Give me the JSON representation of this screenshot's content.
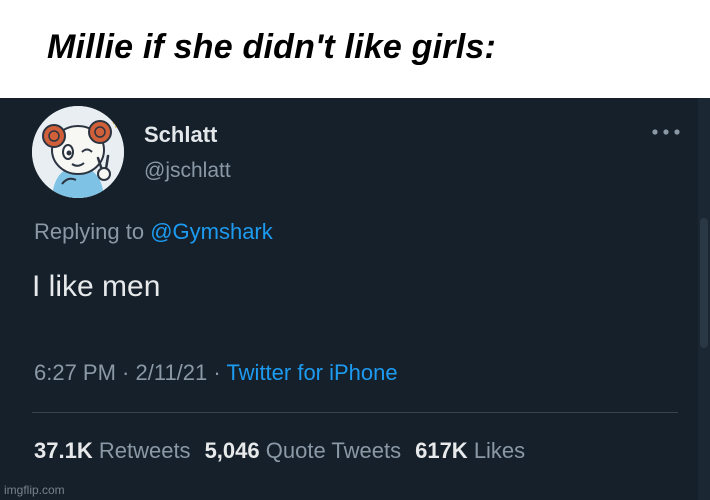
{
  "caption": "Millie if she didn't like girls:",
  "tweet": {
    "display_name": "Schlatt",
    "handle": "@jschlatt",
    "replying_prefix": "Replying to ",
    "replying_to": "@Gymshark",
    "text": "I like men",
    "time": "6:27 PM",
    "date": "2/11/21",
    "source": "Twitter for iPhone",
    "separator": " · ",
    "stats": {
      "retweets_count": "37.1K",
      "retweets_label": "Retweets",
      "quotes_count": "5,046",
      "quotes_label": "Quote Tweets",
      "likes_count": "617K",
      "likes_label": "Likes"
    }
  },
  "icons": {
    "more": "more-horizontal-icon",
    "avatar": "ram-avatar-icon"
  },
  "colors": {
    "background": "#15202b",
    "link": "#1d9bf0",
    "secondary_text": "#8b98a5",
    "primary_text": "#e7e9ea"
  },
  "watermark": "imgflip.com"
}
